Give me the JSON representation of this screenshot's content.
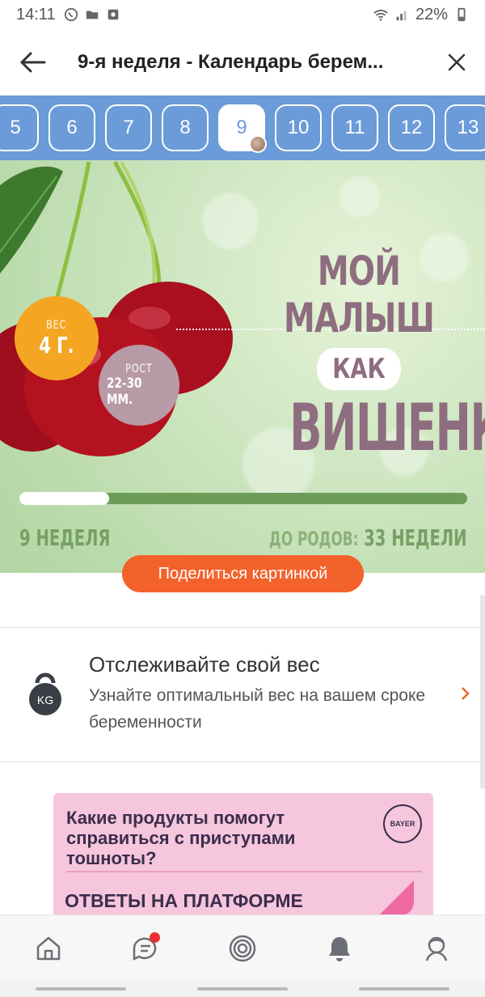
{
  "status": {
    "time": "14:11",
    "battery": "22%"
  },
  "appbar": {
    "title": "9-я неделя - Календарь берем..."
  },
  "weeks": {
    "items": [
      "5",
      "6",
      "7",
      "8",
      "9",
      "10",
      "11",
      "12",
      "13"
    ],
    "selected": "9"
  },
  "hero": {
    "headline_line1": "МОЙ МАЛЫШ",
    "headline_pill": "КАК",
    "headline_line3": "ВИШЕНКА",
    "weight_label": "ВЕС",
    "weight_value": "4 Г.",
    "length_label": "РОСТ",
    "length_value": "22-30 ММ.",
    "week_label": "9 НЕДЕЛЯ",
    "remaining_label": "ДО РОДОВ:",
    "remaining_value": "33 НЕДЕЛИ",
    "progress_fraction": 0.2
  },
  "share_button": "Поделиться картинкой",
  "tracker": {
    "title": "Отслеживайте свой вес",
    "subtitle": "Узнайте оптимальный вес на вашем сроке беременности",
    "icon_text": "KG"
  },
  "ad": {
    "question": "Какие продукты помогут справиться с приступами тошноты?",
    "answers": "ОТВЕТЫ НА ПЛАТФОРМЕ",
    "logo": "BAYER"
  },
  "colors": {
    "primary": "#6b9bd8",
    "accent": "#f4622c",
    "weight_badge": "#f4a623",
    "length_badge": "#b79aa6",
    "headline": "#8d6d7f"
  },
  "icons": {
    "status": [
      "whatsapp-icon",
      "folder-icon",
      "camera-icon",
      "wifi-icon",
      "signal-icon",
      "battery-icon"
    ],
    "nav": [
      "home-icon",
      "chat-icon",
      "target-icon",
      "bell-icon",
      "profile-icon"
    ]
  }
}
